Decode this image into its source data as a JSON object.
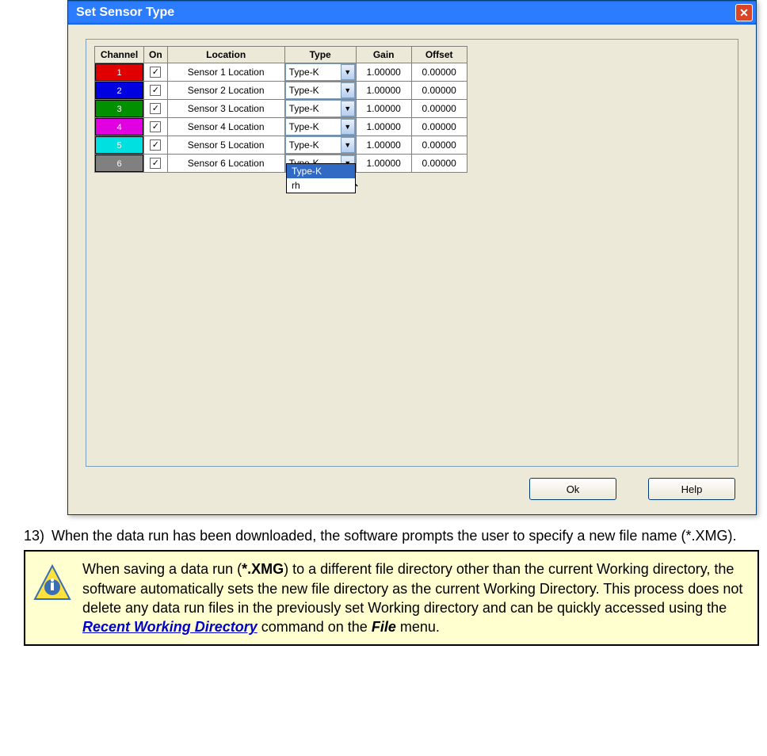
{
  "dialog": {
    "title": "Set Sensor Type",
    "headers": {
      "channel": "Channel",
      "on": "On",
      "location": "Location",
      "type": "Type",
      "gain": "Gain",
      "offset": "Offset"
    },
    "rows": [
      {
        "num": "1",
        "color": "#e00000",
        "loc": "Sensor 1 Location",
        "type": "Type-K",
        "gain": "1.00000",
        "offset": "0.00000"
      },
      {
        "num": "2",
        "color": "#0000e0",
        "loc": "Sensor 2 Location",
        "type": "Type-K",
        "gain": "1.00000",
        "offset": "0.00000"
      },
      {
        "num": "3",
        "color": "#009000",
        "loc": "Sensor 3 Location",
        "type": "Type-K",
        "gain": "1.00000",
        "offset": "0.00000"
      },
      {
        "num": "4",
        "color": "#e000e0",
        "loc": "Sensor 4 Location",
        "type": "Type-K",
        "gain": "1.00000",
        "offset": "0.00000"
      },
      {
        "num": "5",
        "color": "#00e0e0",
        "loc": "Sensor 5 Location",
        "type": "Type-K",
        "gain": "1.00000",
        "offset": "0.00000"
      },
      {
        "num": "6",
        "color": "#808080",
        "loc": "Sensor 6 Location",
        "type": "Type-K",
        "gain": "1.00000",
        "offset": "0.00000"
      }
    ],
    "dropdown": {
      "opt1": "Type-K",
      "opt2": "rh"
    },
    "buttons": {
      "ok": "Ok",
      "help": "Help"
    }
  },
  "step": {
    "num": "13)",
    "text": "When the data run has been downloaded, the software prompts the user to specify a new file name (*.XMG)."
  },
  "note": {
    "p1a": "When saving a data run (",
    "p1b": "*.XMG",
    "p1c": ") to a different file directory other than the current Working directory, the software automatically sets the new file directory as the current Working Directory. This process does not delete any data run files in the previously set Working directory and can be quickly accessed using the ",
    "link": "Recent Working Directory",
    "p1d": " command on the ",
    "menu": "File",
    "p1e": " menu."
  }
}
